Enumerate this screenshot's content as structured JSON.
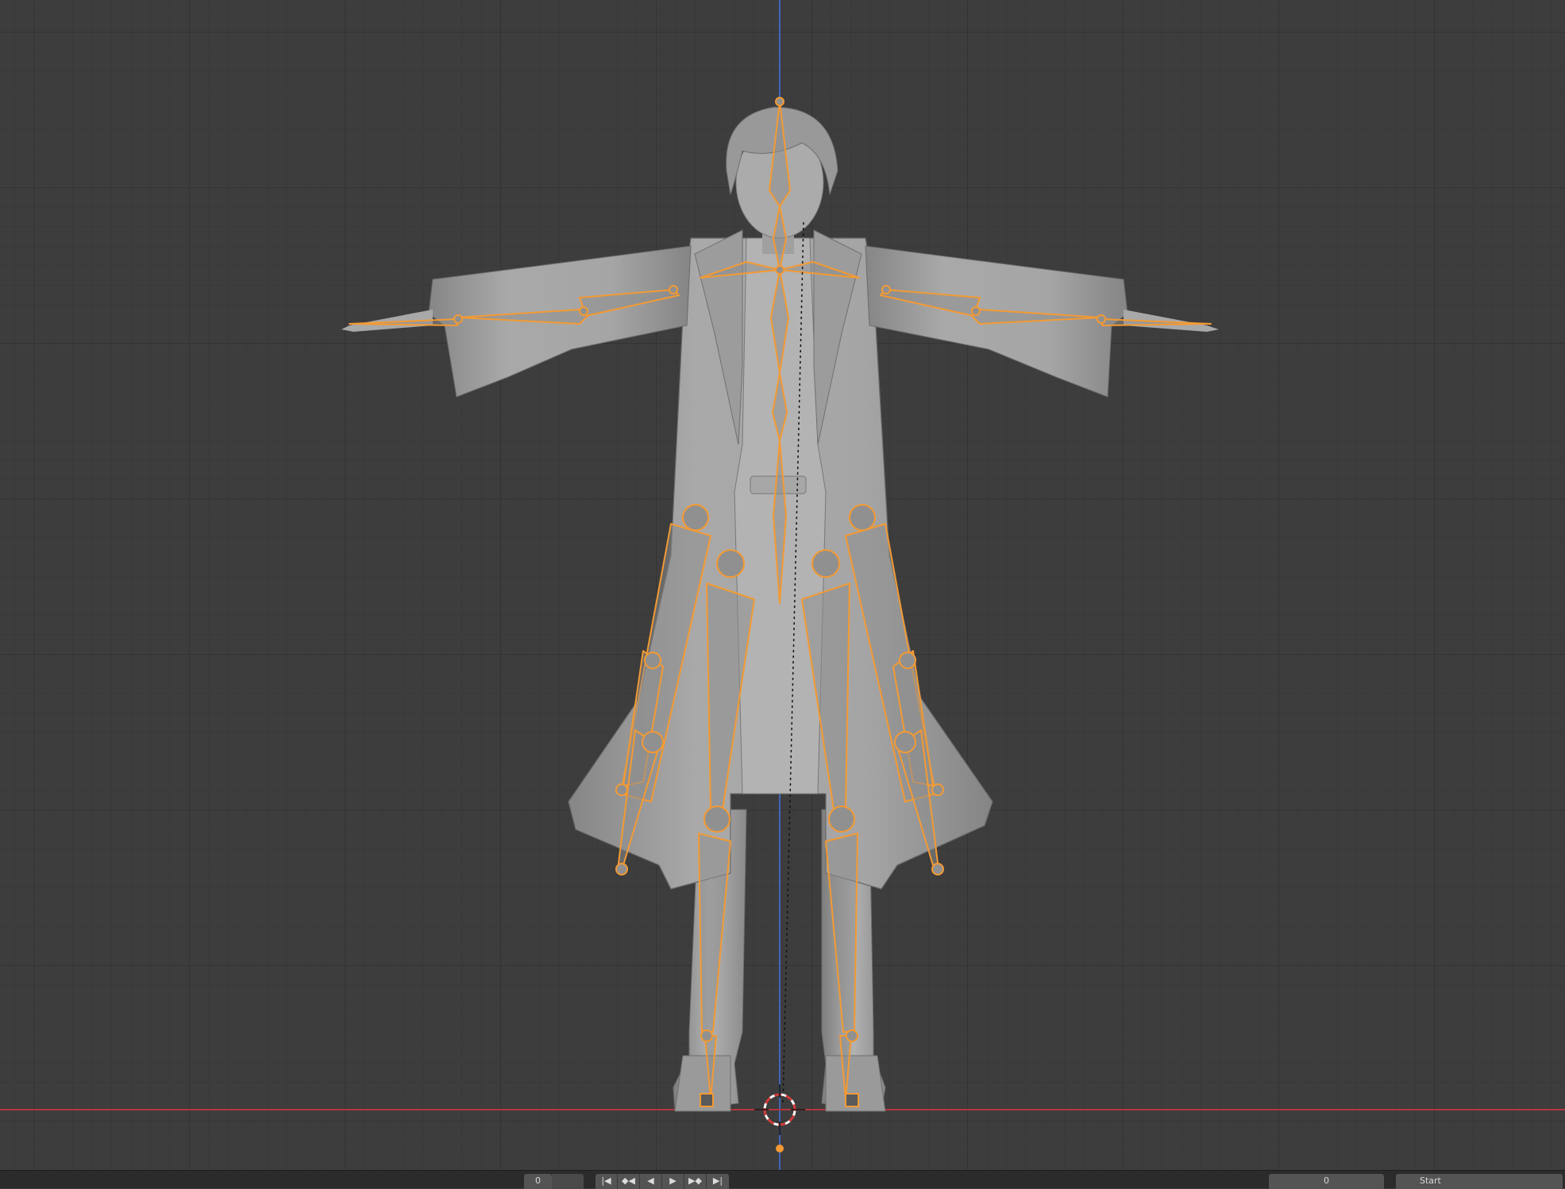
{
  "app": "Blender",
  "viewport": {
    "view": "front-orthographic",
    "mode": "pose",
    "object": "character-with-armature",
    "colors": {
      "background": "#3d3d3d",
      "grid_minor": "#393939",
      "grid_major": "#333333",
      "axis_x": "#b5363c",
      "axis_z": "#3f66b8",
      "bone_selected": "#f39a34",
      "bone_fill": "#8e8e8e",
      "mesh": "#a0a0a0"
    }
  },
  "timeline": {
    "frame_field": "0",
    "transport_icons": [
      "jump-start-icon",
      "prev-keyframe-icon",
      "play-reverse-icon",
      "play-icon",
      "next-keyframe-icon",
      "jump-end-icon"
    ],
    "right_fields": [
      "0",
      "Start"
    ]
  }
}
